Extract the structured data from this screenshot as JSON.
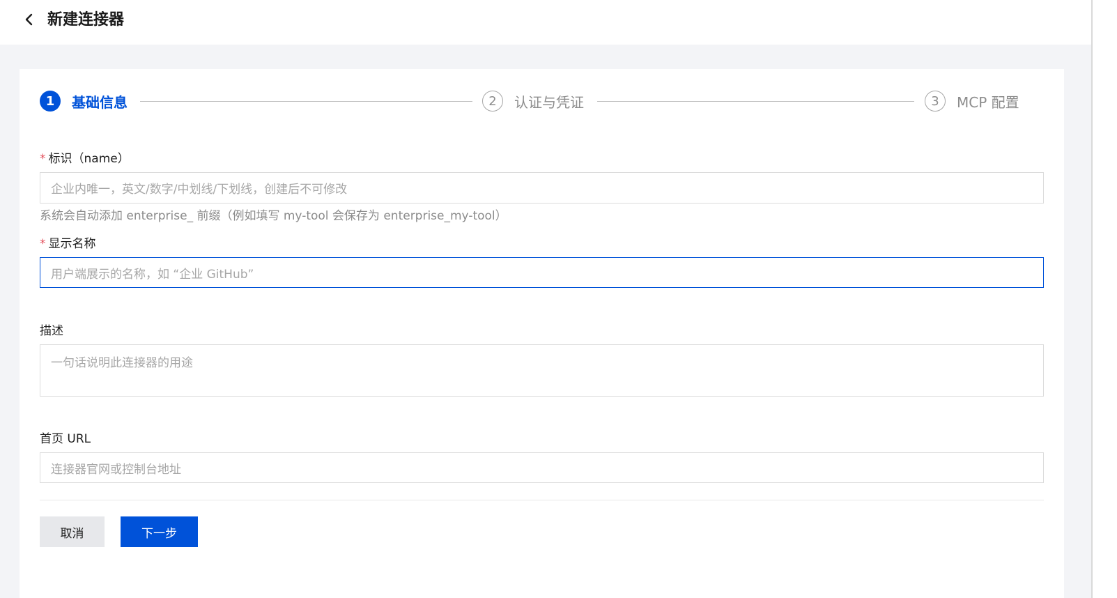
{
  "header": {
    "title": "新建连接器"
  },
  "steps": [
    {
      "number": "1",
      "label": "基础信息",
      "state": "active"
    },
    {
      "number": "2",
      "label": "认证与凭证",
      "state": "inactive"
    },
    {
      "number": "3",
      "label": "MCP 配置",
      "state": "inactive"
    }
  ],
  "form": {
    "name": {
      "required_mark": "*",
      "label": "标识（name）",
      "placeholder": "企业内唯一，英文/数字/中划线/下划线，创建后不可修改",
      "help": "系统会自动添加 enterprise_ 前缀（例如填写 my-tool 会保存为 enterprise_my-tool）"
    },
    "display_name": {
      "required_mark": "*",
      "label": "显示名称",
      "placeholder": "用户端展示的名称，如 “企业 GitHub”"
    },
    "description": {
      "label": "描述",
      "placeholder": "一句话说明此连接器的用途"
    },
    "homepage": {
      "label": "首页 URL",
      "placeholder": "连接器官网或控制台地址"
    }
  },
  "actions": {
    "cancel_label": "取消",
    "next_label": "下一步"
  },
  "colors": {
    "primary": "#0052d9",
    "required": "#e34d59",
    "background": "#f3f4f7"
  }
}
